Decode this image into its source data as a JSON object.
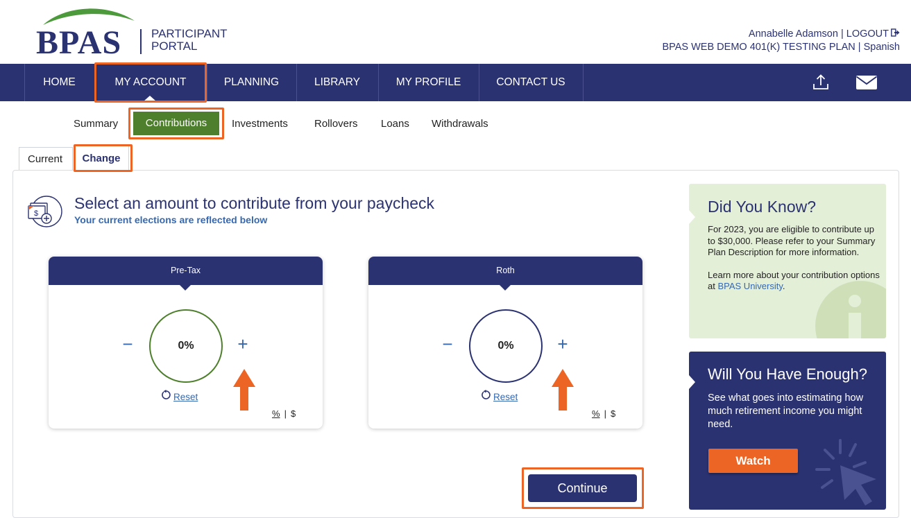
{
  "brand": {
    "logo_text": "BPAS",
    "portal_line1": "PARTICIPANT",
    "portal_line2": "PORTAL"
  },
  "user": {
    "name": "Annabelle Adamson",
    "separator": "|",
    "logout": "LOGOUT",
    "plan": "BPAS WEB DEMO 401(K) TESTING PLAN",
    "language": "Spanish"
  },
  "nav": {
    "items": [
      {
        "label": "HOME"
      },
      {
        "label": "MY ACCOUNT"
      },
      {
        "label": "PLANNING"
      },
      {
        "label": "LIBRARY"
      },
      {
        "label": "MY PROFILE"
      },
      {
        "label": "CONTACT US"
      }
    ],
    "active": "MY ACCOUNT",
    "icons": [
      "upload-icon",
      "mail-icon"
    ]
  },
  "subnav": {
    "items": [
      {
        "label": "Summary"
      },
      {
        "label": "Contributions"
      },
      {
        "label": "Investments"
      },
      {
        "label": "Rollovers"
      },
      {
        "label": "Loans"
      },
      {
        "label": "Withdrawals"
      }
    ],
    "active": "Contributions"
  },
  "tabs": {
    "current": "Current",
    "change": "Change",
    "active": "Change"
  },
  "contribution": {
    "title": "Select an amount to contribute from your paycheck",
    "subtitle": "Your current elections are reflected below",
    "cards": [
      {
        "label": "Pre-Tax",
        "value": "0%",
        "minus": "−",
        "plus": "+",
        "reset": "Reset",
        "unit_pct": "%",
        "unit_sep": "|",
        "unit_usd": "$"
      },
      {
        "label": "Roth",
        "value": "0%",
        "minus": "−",
        "plus": "+",
        "reset": "Reset",
        "unit_pct": "%",
        "unit_sep": "|",
        "unit_usd": "$"
      }
    ],
    "continue_label": "Continue"
  },
  "did_you_know": {
    "title": "Did You Know?",
    "body1": "For 2023, you are eligible to contribute up to $30,000. Please refer to your Summary Plan Description for more information.",
    "body2_prefix": "Learn more about your contribution options at ",
    "body2_link": "BPAS University",
    "body2_suffix": "."
  },
  "will_you_have_enough": {
    "title": "Will You Have Enough?",
    "body": "See what goes into estimating how much retirement income you might need.",
    "button": "Watch"
  },
  "colors": {
    "navy": "#2b3271",
    "green": "#4d7f2c",
    "orange": "#ec6524",
    "link_blue": "#3568b0",
    "light_green": "#e4efd8"
  }
}
